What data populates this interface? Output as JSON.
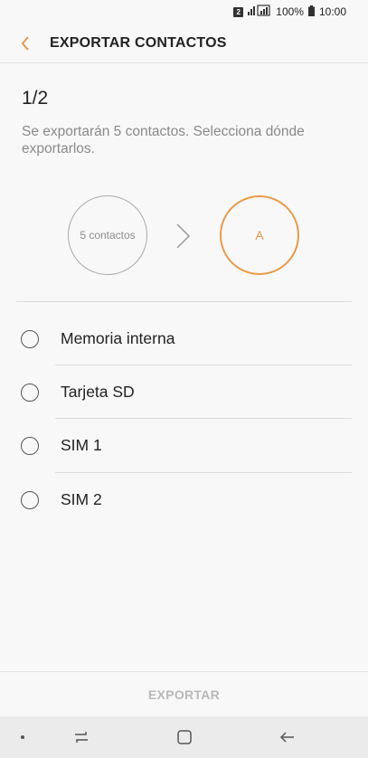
{
  "status_bar": {
    "sim_badge": "2",
    "battery": "100%",
    "time": "10:00"
  },
  "header": {
    "back_icon": "chevron-left-icon",
    "title": "EXPORTAR CONTACTOS"
  },
  "step": "1/2",
  "description": "Se exportarán 5 contactos. Selecciona dónde exportarlos.",
  "diagram": {
    "source_label": "5 contactos",
    "arrow_icon": "chevron-right-icon",
    "destination_label": "A"
  },
  "options": [
    {
      "label": "Memoria interna"
    },
    {
      "label": "Tarjeta SD"
    },
    {
      "label": "SIM 1"
    },
    {
      "label": "SIM 2"
    }
  ],
  "footer": {
    "export_label": "EXPORTAR"
  },
  "colors": {
    "accent": "#e99a47",
    "disabled_text": "#b8b8b8"
  }
}
